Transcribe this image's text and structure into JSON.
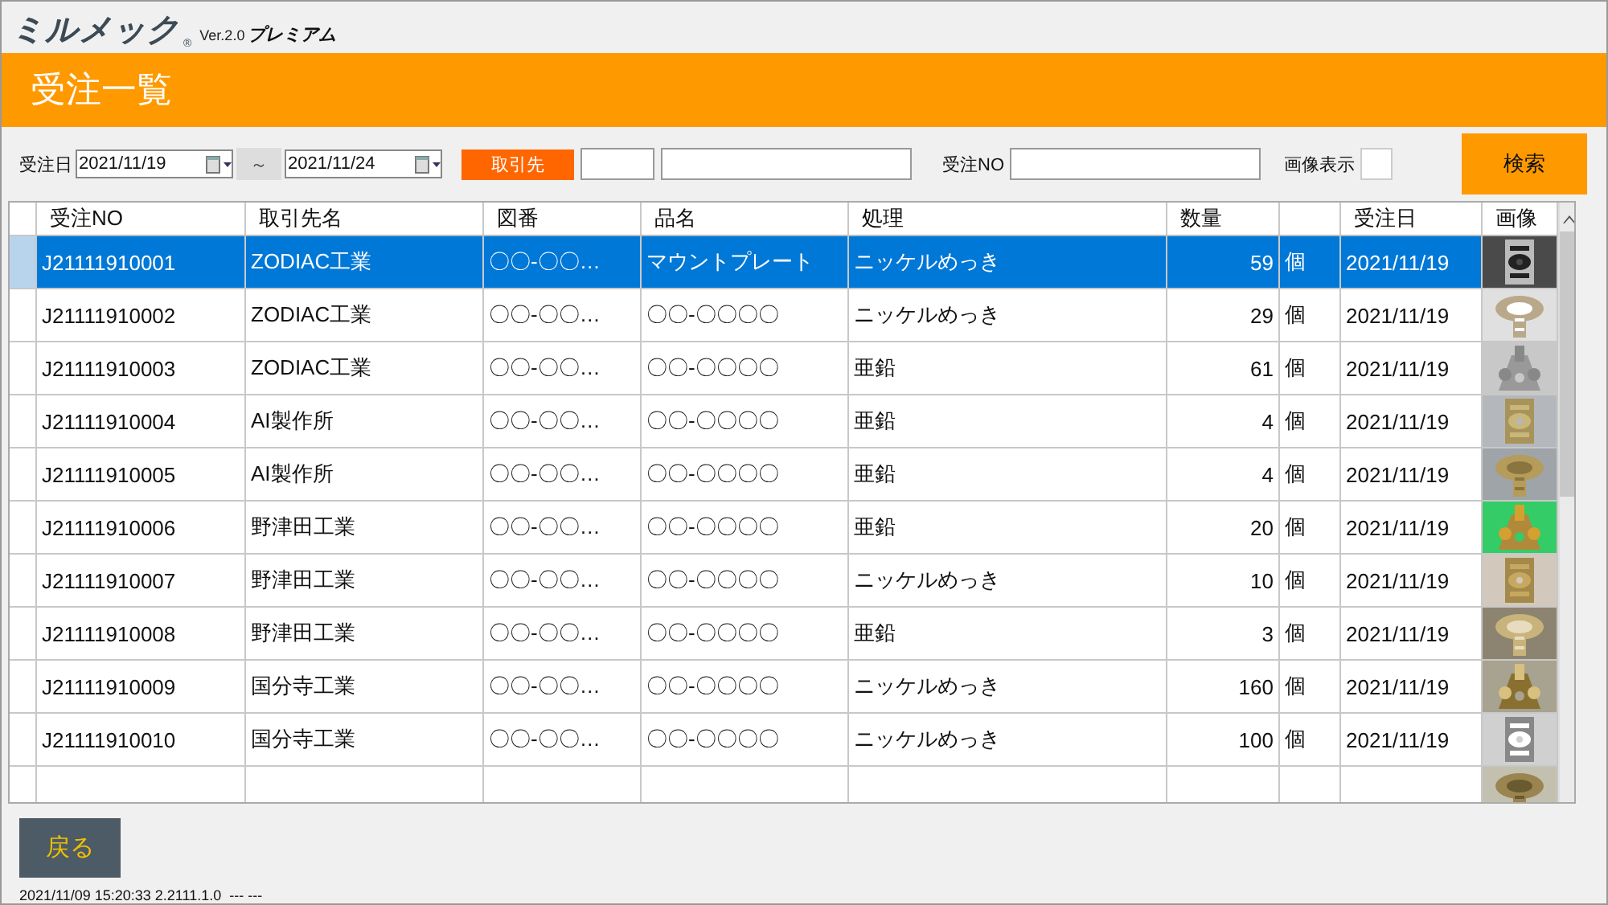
{
  "app": {
    "logo": "ミルメック",
    "registered": "®",
    "version": "Ver.2.0",
    "edition": "プレミアム"
  },
  "page_title": "受注一覧",
  "filters": {
    "date_label": "受注日",
    "date_from": "2021/11/19",
    "range_sep": "～",
    "date_to": "2021/11/24",
    "client_button": "取引先",
    "order_no_label": "受注NO",
    "image_display_label": "画像表示",
    "image_display_checked": false,
    "search_button": "検索"
  },
  "table": {
    "columns": [
      {
        "label": "受注NO"
      },
      {
        "label": "取引先名"
      },
      {
        "label": "図番"
      },
      {
        "label": "品名"
      },
      {
        "label": "処理"
      },
      {
        "label": "数量"
      },
      {},
      {
        "label": "受注日"
      },
      {
        "label": "画像"
      }
    ],
    "rows": [
      {
        "selected": true,
        "cells": [
          "J21111910001",
          "ZODIAC工業",
          "〇〇-〇〇…",
          "マウントプレート",
          "ニッケルめっき",
          "59",
          "個",
          "2021/11/19"
        ]
      },
      {
        "selected": false,
        "cells": [
          "J21111910002",
          "ZODIAC工業",
          "〇〇-〇〇…",
          "〇〇-〇〇〇〇",
          "ニッケルめっき",
          "29",
          "個",
          "2021/11/19"
        ]
      },
      {
        "selected": false,
        "cells": [
          "J21111910003",
          "ZODIAC工業",
          "〇〇-〇〇…",
          "〇〇-〇〇〇〇",
          "亜鉛",
          "61",
          "個",
          "2021/11/19"
        ]
      },
      {
        "selected": false,
        "cells": [
          "J21111910004",
          "AI製作所",
          "〇〇-〇〇…",
          "〇〇-〇〇〇〇",
          "亜鉛",
          "4",
          "個",
          "2021/11/19"
        ]
      },
      {
        "selected": false,
        "cells": [
          "J21111910005",
          "AI製作所",
          "〇〇-〇〇…",
          "〇〇-〇〇〇〇",
          "亜鉛",
          "4",
          "個",
          "2021/11/19"
        ]
      },
      {
        "selected": false,
        "cells": [
          "J21111910006",
          "野津田工業",
          "〇〇-〇〇…",
          "〇〇-〇〇〇〇",
          "亜鉛",
          "20",
          "個",
          "2021/11/19"
        ]
      },
      {
        "selected": false,
        "cells": [
          "J21111910007",
          "野津田工業",
          "〇〇-〇〇…",
          "〇〇-〇〇〇〇",
          "ニッケルめっき",
          "10",
          "個",
          "2021/11/19"
        ]
      },
      {
        "selected": false,
        "cells": [
          "J21111910008",
          "野津田工業",
          "〇〇-〇〇…",
          "〇〇-〇〇〇〇",
          "亜鉛",
          "3",
          "個",
          "2021/11/19"
        ]
      },
      {
        "selected": false,
        "cells": [
          "J21111910009",
          "国分寺工業",
          "〇〇-〇〇…",
          "〇〇-〇〇〇〇",
          "ニッケルめっき",
          "160",
          "個",
          "2021/11/19"
        ]
      },
      {
        "selected": false,
        "cells": [
          "J21111910010",
          "国分寺工業",
          "〇〇-〇〇…",
          "〇〇-〇〇〇〇",
          "ニッケルめっき",
          "100",
          "個",
          "2021/11/19"
        ]
      }
    ]
  },
  "footer": {
    "back_button": "戻る",
    "status": "2021/11/09 15:20:33 2.2111.1.0  --- ---"
  }
}
